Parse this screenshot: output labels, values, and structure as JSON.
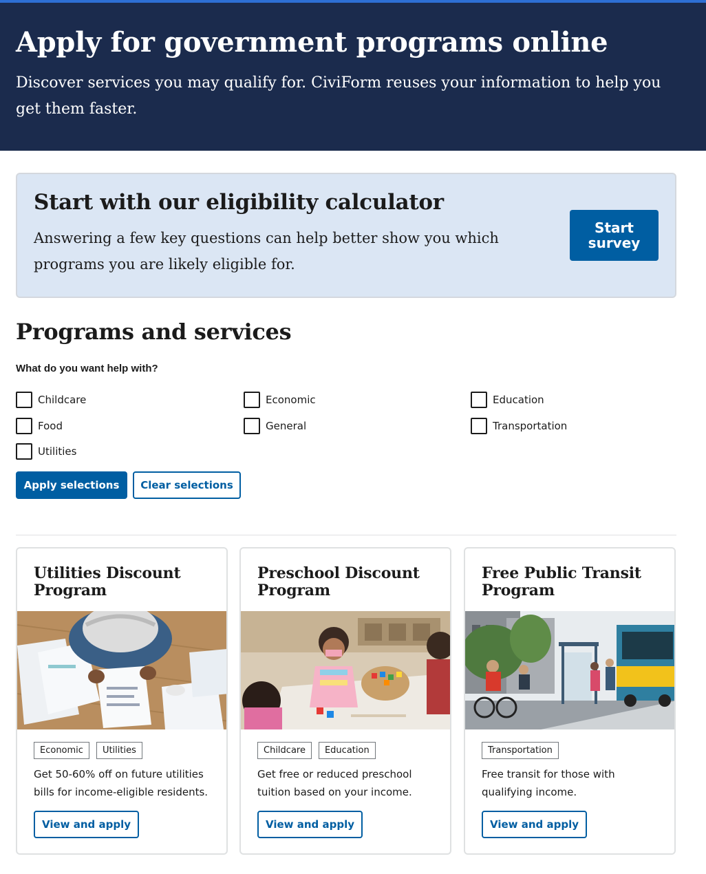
{
  "hero": {
    "title": "Apply for government programs online",
    "subtitle": "Discover services you may qualify for. CiviForm reuses your information to help you get them faster."
  },
  "calculator": {
    "title": "Start with our eligibility calculator",
    "description": "Answering a few key questions can help better show you which programs you are likely eligible for.",
    "button_label": "Start survey"
  },
  "programs": {
    "title": "Programs and services",
    "filter_label": "What do you want help with?",
    "categories": [
      {
        "label": "Childcare",
        "checked": false
      },
      {
        "label": "Economic",
        "checked": false
      },
      {
        "label": "Education",
        "checked": false
      },
      {
        "label": "Food",
        "checked": false
      },
      {
        "label": "General",
        "checked": false
      },
      {
        "label": "Transportation",
        "checked": false
      },
      {
        "label": "Utilities",
        "checked": false
      }
    ],
    "apply_label": "Apply selections",
    "clear_label": "Clear selections"
  },
  "cards": [
    {
      "title": "Utilities Discount Program",
      "tags": [
        "Economic",
        "Utilities"
      ],
      "description": "Get 50-60% off on future utilities bills for income-eligible residents.",
      "button_label": "View and apply",
      "image": "bills-paperwork-photo"
    },
    {
      "title": "Preschool Discount Program",
      "tags": [
        "Childcare",
        "Education"
      ],
      "description": "Get free or reduced preschool tuition based on your income.",
      "button_label": "View and apply",
      "image": "children-playing-photo"
    },
    {
      "title": "Free Public Transit Program",
      "tags": [
        "Transportation"
      ],
      "description": "Free transit for those with qualifying income.",
      "button_label": "View and apply",
      "image": "bus-stop-street-photo"
    }
  ],
  "colors": {
    "hero_bg": "#1b2b4d",
    "primary": "#005ea2",
    "calc_bg": "#dbe6f4",
    "top_accent": "#2d6fd4"
  }
}
